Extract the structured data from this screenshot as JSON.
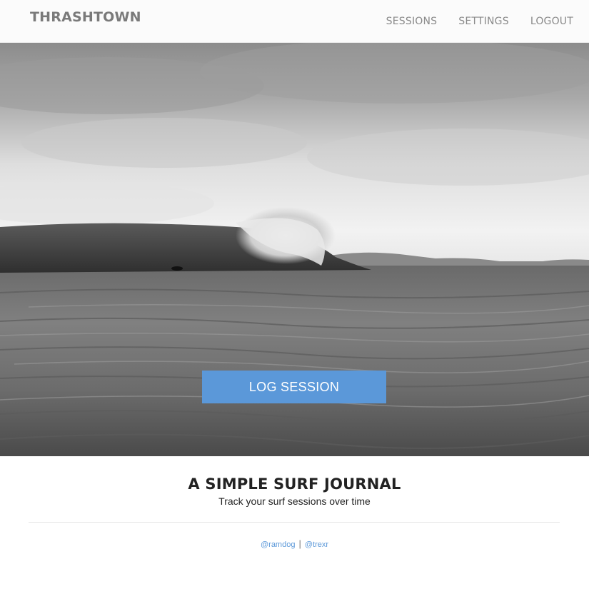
{
  "navbar": {
    "brand": "THRASHTOWN",
    "links": [
      {
        "label": "SESSIONS"
      },
      {
        "label": "SETTINGS"
      },
      {
        "label": "LOGOUT"
      }
    ]
  },
  "hero": {
    "image": "black-and-white-ocean-wave-surfer-photo",
    "cta_label": "LOG SESSION",
    "cta_color": "#5b98d9"
  },
  "intro": {
    "title": "A SIMPLE SURF JOURNAL",
    "subtitle": "Track your surf sessions over time"
  },
  "footer": {
    "links": [
      {
        "label": "@ramdog"
      },
      {
        "label": "@trexr"
      }
    ],
    "separator": "|"
  }
}
